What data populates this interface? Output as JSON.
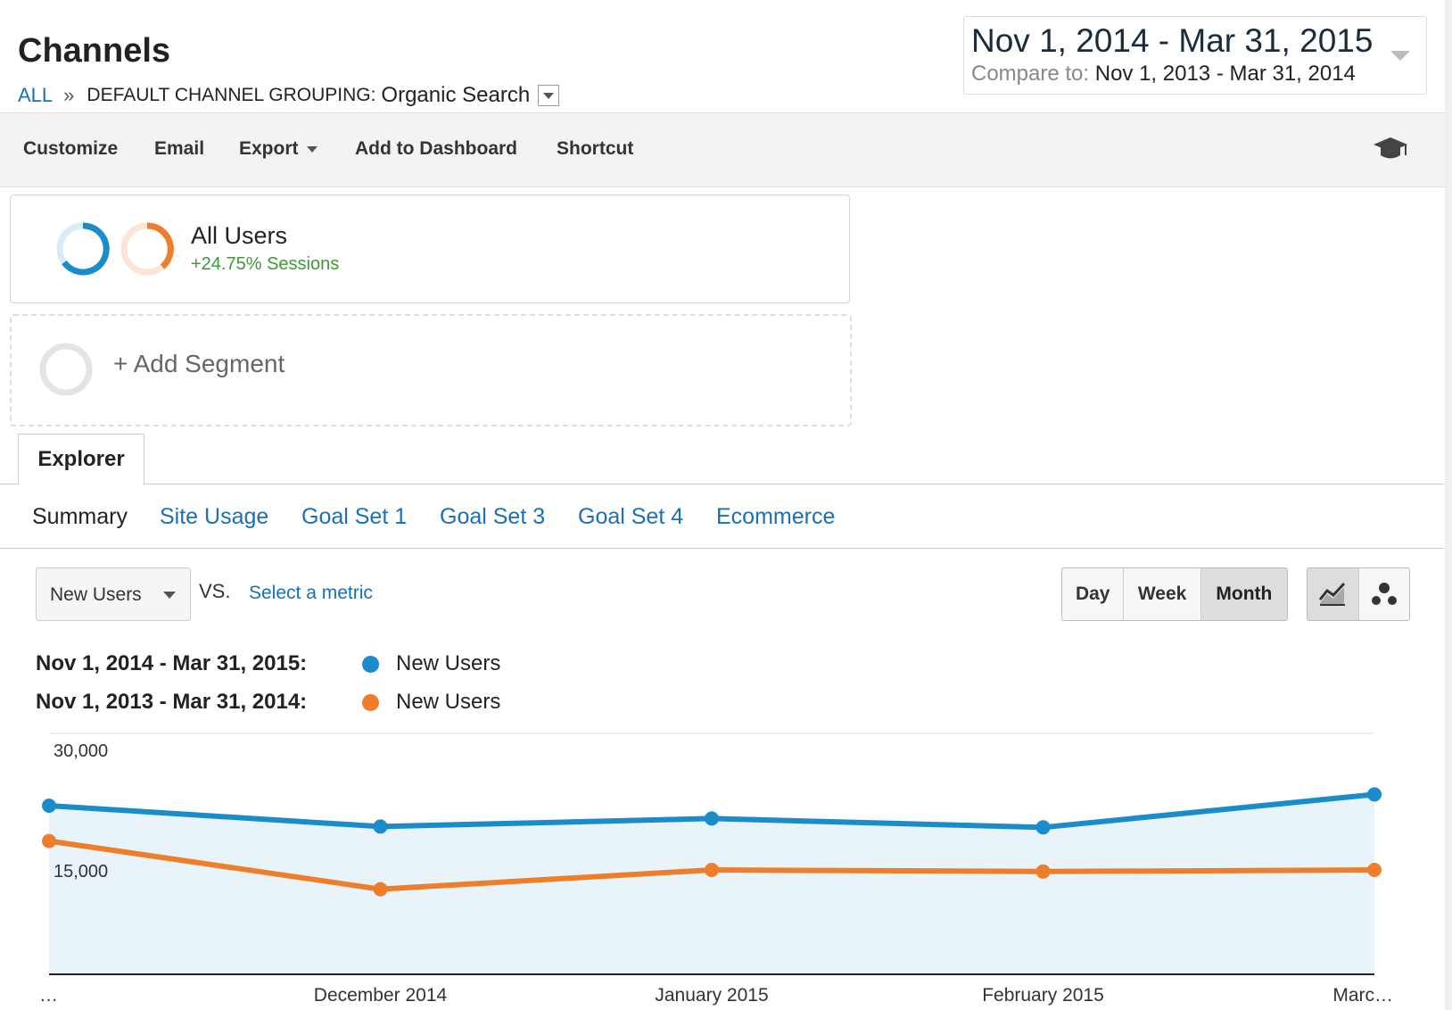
{
  "header": {
    "title": "Channels",
    "breadcrumb": {
      "all": "ALL",
      "separator": "»",
      "grouping": "DEFAULT CHANNEL GROUPING:",
      "value": "Organic Search"
    },
    "date_range": "Nov 1, 2014 - Mar 31, 2015",
    "compare_label": "Compare to:",
    "compare_range": "Nov 1, 2013 - Mar 31, 2014"
  },
  "toolbar": {
    "customize": "Customize",
    "email": "Email",
    "export": "Export",
    "add_to_dashboard": "Add to Dashboard",
    "shortcut": "Shortcut"
  },
  "segments": {
    "all_users_title": "All Users",
    "all_users_sub": "+24.75% Sessions",
    "add_segment": "+ Add Segment"
  },
  "tabs": {
    "explorer": "Explorer",
    "subtabs": [
      "Summary",
      "Site Usage",
      "Goal Set 1",
      "Goal Set 3",
      "Goal Set 4",
      "Ecommerce"
    ]
  },
  "controls": {
    "metric": "New Users",
    "vs": "VS.",
    "select_metric": "Select a metric",
    "periods": [
      "Day",
      "Week",
      "Month"
    ],
    "active_period": "Month"
  },
  "legend": [
    {
      "range": "Nov 1, 2014 - Mar 31, 2015:",
      "name": "New Users",
      "color": "#1b8ccb"
    },
    {
      "range": "Nov 1, 2013 - Mar 31, 2014:",
      "name": "New Users",
      "color": "#ed7f2c"
    }
  ],
  "chart_data": {
    "type": "line",
    "categories": [
      "…",
      "December 2014",
      "January 2015",
      "February 2015",
      "Marc…"
    ],
    "series": [
      {
        "name": "New Users",
        "color": "#1b8ccb",
        "values": [
          21000,
          18400,
          19400,
          18300,
          22400
        ]
      },
      {
        "name": "New Users",
        "color": "#ed7f2c",
        "values": [
          16600,
          10600,
          13000,
          12800,
          13000
        ]
      }
    ],
    "ylim": [
      0,
      30000
    ],
    "yticks": [
      "15,000",
      "30,000"
    ],
    "grid": true
  }
}
